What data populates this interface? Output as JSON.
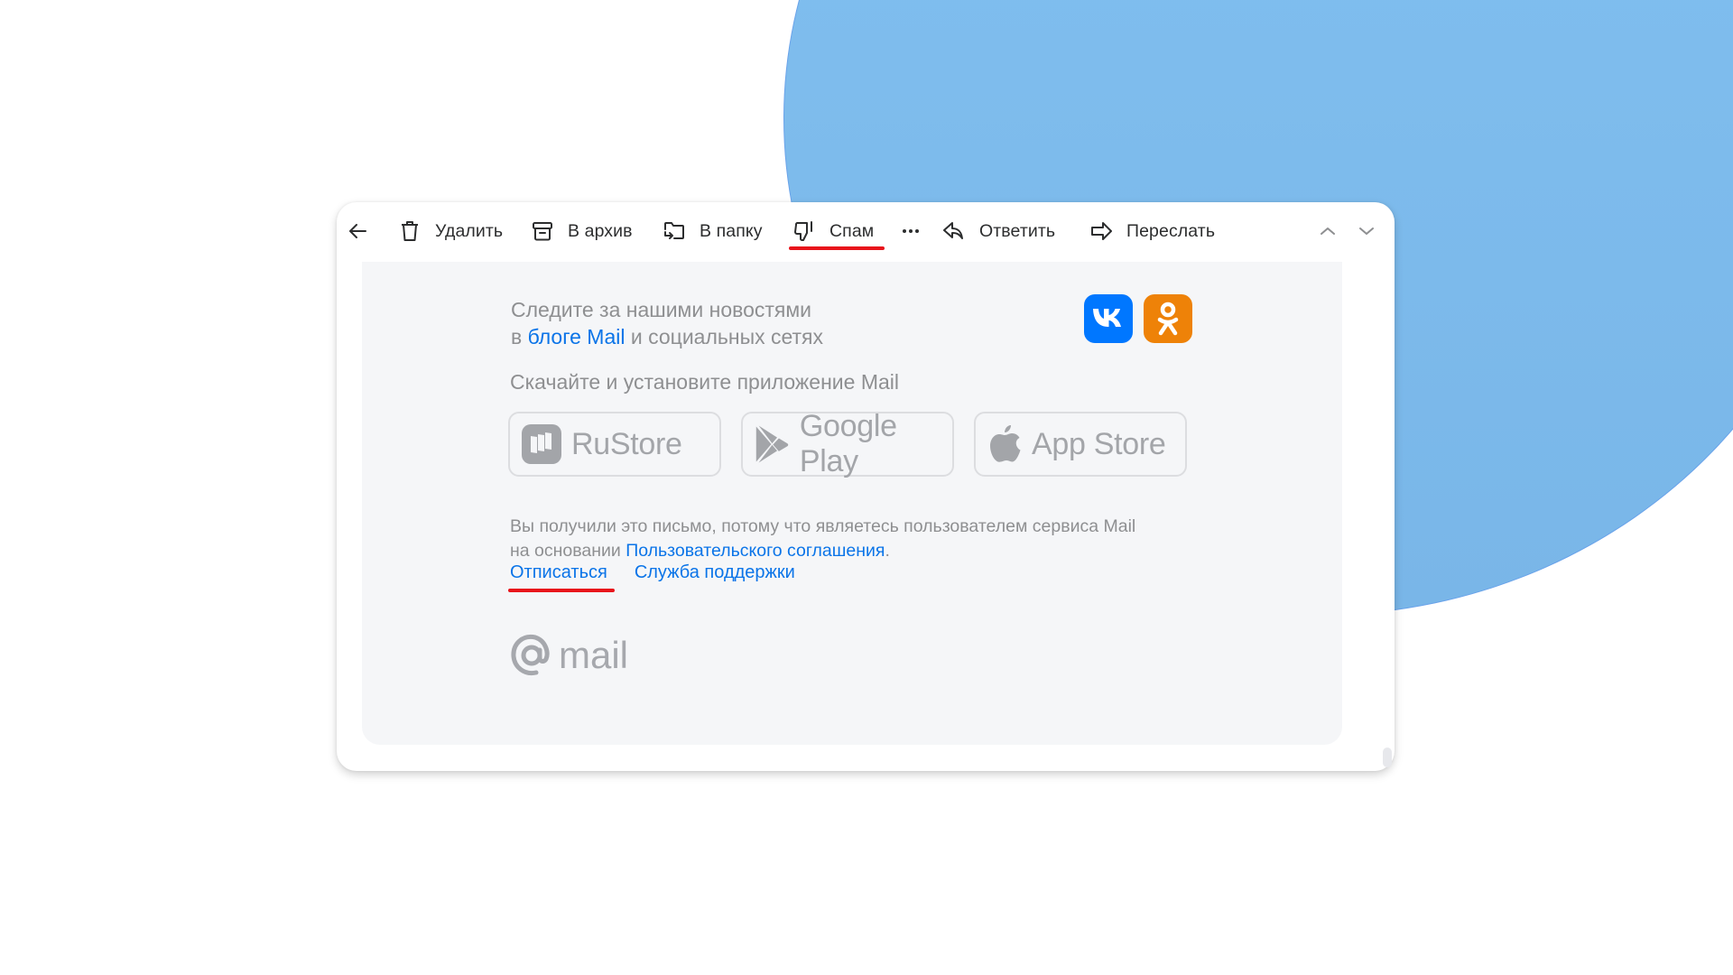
{
  "toolbar": {
    "back_icon": "arrow-left-icon",
    "delete": {
      "label": "Удалить",
      "icon": "trash-icon"
    },
    "archive": {
      "label": "В архив",
      "icon": "archive-box-icon"
    },
    "move": {
      "label": "В папку",
      "icon": "folder-move-icon"
    },
    "spam": {
      "label": "Спам",
      "icon": "thumbs-down-icon"
    },
    "more_icon": "more-dots-icon",
    "reply": {
      "label": "Ответить",
      "icon": "reply-icon"
    },
    "forward": {
      "label": "Переслать",
      "icon": "forward-icon"
    },
    "prev_icon": "chevron-up-icon",
    "next_icon": "chevron-down-icon"
  },
  "email": {
    "news_line1": "Следите за нашими новостями",
    "news_line2_prefix": "в ",
    "news_link": "блоге Mail",
    "news_line2_suffix": " и социальных сетях",
    "social": [
      {
        "name": "VK",
        "color": "#0077ff"
      },
      {
        "name": "OK",
        "color": "#ee8208"
      }
    ],
    "download_text": "Скачайте и установите приложение Mail",
    "stores": [
      {
        "label": "RuStore"
      },
      {
        "label": "Google Play"
      },
      {
        "label": "App Store"
      }
    ],
    "legal_line1": "Вы получили это письмо, потому что являетесь пользователем сервиса Mail",
    "legal_line2_prefix": "на основании ",
    "legal_link": "Пользовательского соглашения",
    "legal_line2_suffix": ".",
    "unsubscribe": "Отписаться",
    "support": "Служба поддержки",
    "brand": "mail"
  },
  "colors": {
    "accent_link": "#0a74e8",
    "highlight_red": "#e8141b",
    "background_blob": "#82c1f1"
  }
}
